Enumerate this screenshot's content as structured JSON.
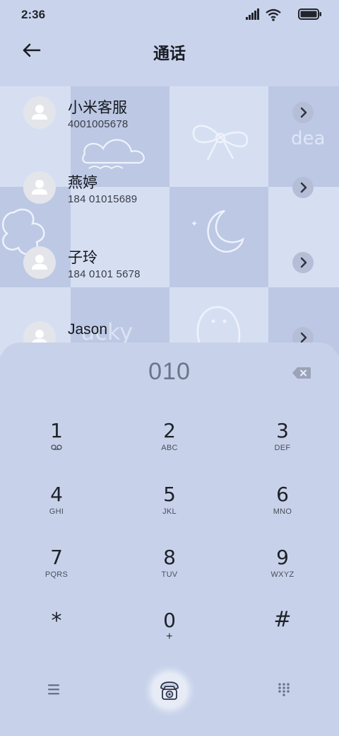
{
  "status_bar": {
    "time": "2:36",
    "icons": [
      "signal-icon",
      "wifi-icon",
      "battery-icon"
    ]
  },
  "header": {
    "title": "通话",
    "back_icon": "back-arrow-icon"
  },
  "contacts": [
    {
      "name": "小米客服",
      "number": "4001005678"
    },
    {
      "name": "燕婷",
      "number": "184 01015689"
    },
    {
      "name": "子玲",
      "number": "184 0101 5678"
    },
    {
      "name": "Jason",
      "number": ""
    }
  ],
  "dialer": {
    "number": "010",
    "keys": [
      {
        "digit": "1",
        "letters": "",
        "icon": "voicemail-icon"
      },
      {
        "digit": "2",
        "letters": "ABC"
      },
      {
        "digit": "3",
        "letters": "DEF"
      },
      {
        "digit": "4",
        "letters": "GHI"
      },
      {
        "digit": "5",
        "letters": "JKL"
      },
      {
        "digit": "6",
        "letters": "MNO"
      },
      {
        "digit": "7",
        "letters": "PQRS"
      },
      {
        "digit": "8",
        "letters": "TUV"
      },
      {
        "digit": "9",
        "letters": "WXYZ"
      },
      {
        "digit": "*",
        "letters": ""
      },
      {
        "digit": "0",
        "letters": "+"
      },
      {
        "digit": "#",
        "letters": ""
      }
    ]
  },
  "bottom_bar": {
    "icons": [
      "menu-icon",
      "telephone-icon",
      "keypad-icon"
    ]
  },
  "colors": {
    "background": "#c7d2ea",
    "tile_light": "#d6dff2",
    "tile_dark": "#bac6e2",
    "text_primary": "#1a1c24",
    "dial_number": "#6c7488"
  }
}
